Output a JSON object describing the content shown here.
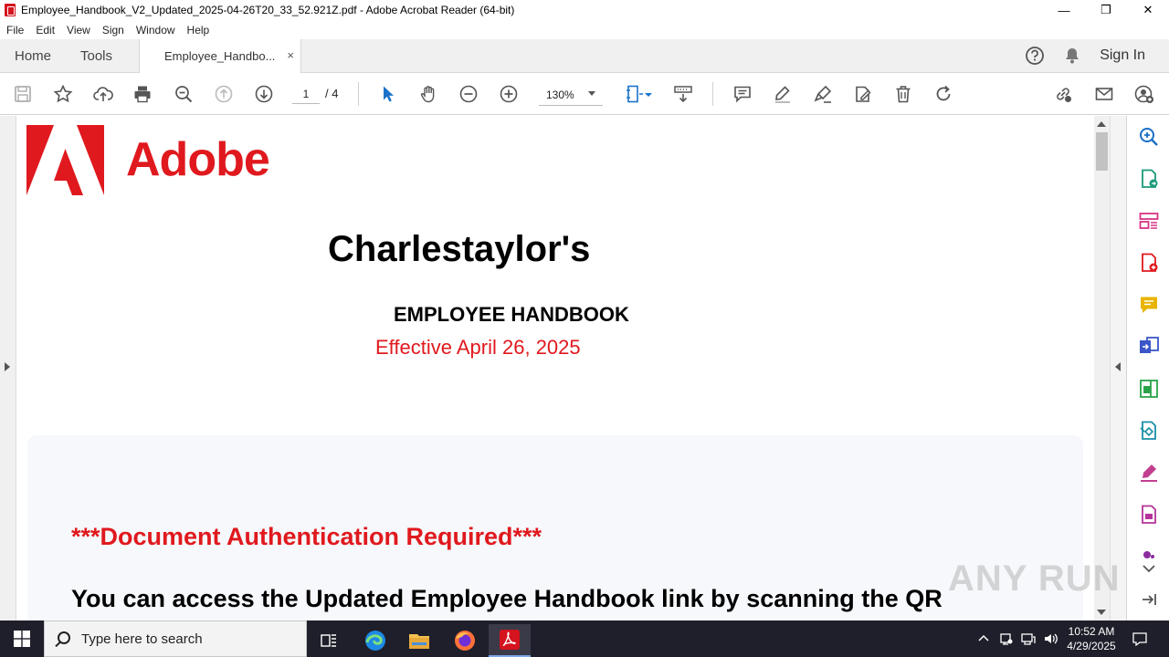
{
  "window": {
    "title": "Employee_Handbook_V2_Updated_2025-04-26T20_33_52.921Z.pdf - Adobe Acrobat Reader (64-bit)",
    "minimize": "—",
    "maximize": "❒",
    "close": "✕"
  },
  "menu": [
    "File",
    "Edit",
    "View",
    "Sign",
    "Window",
    "Help"
  ],
  "tabs": {
    "home": "Home",
    "tools": "Tools",
    "document": "Employee_Handbo...",
    "close": "×"
  },
  "header_right": {
    "sign_in": "Sign In"
  },
  "toolbar": {
    "page_current": "1",
    "page_total": "/ 4",
    "zoom": "130%"
  },
  "document": {
    "logo_text": "Adobe",
    "title": "Charlestaylor's",
    "subtitle": "EMPLOYEE HANDBOOK",
    "effective": "Effective April 26, 2025",
    "notice_heading": "***Document Authentication Required***",
    "notice_body": "You can access the Updated Employee Handbook link by scanning the QR"
  },
  "watermark": "ANY RUN",
  "taskbar": {
    "search_placeholder": "Type here to search",
    "time": "10:52 AM",
    "date": "4/29/2025"
  },
  "colors": {
    "adobe_red": "#e0191e",
    "accent_blue": "#1a73c8"
  }
}
